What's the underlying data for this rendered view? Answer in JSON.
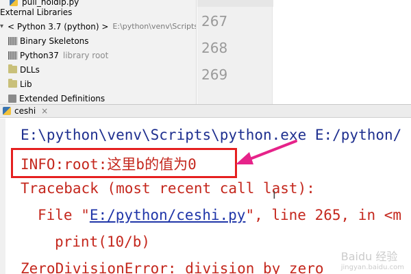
{
  "project_tree": {
    "items": [
      {
        "label": "pull_holdip.py",
        "icon": "python-file-icon"
      },
      {
        "label": "External Libraries",
        "icon": "library-icon"
      },
      {
        "label": "< Python 3.7 (python) >",
        "path": "E:\\python\\venv\\Scripts\\",
        "icon": "chevron-down-icon"
      },
      {
        "label": "Binary Skeletons",
        "icon": "library-icon"
      },
      {
        "label": "Python37",
        "hint": "library root",
        "icon": "library-icon"
      },
      {
        "label": "DLLs",
        "icon": "folder-icon"
      },
      {
        "label": "Lib",
        "icon": "folder-icon"
      },
      {
        "label": "Extended Definitions",
        "icon": "library-icon"
      }
    ]
  },
  "editor": {
    "line_numbers": [
      "267",
      "268",
      "269"
    ]
  },
  "run_panel": {
    "tab_label": "ceshi",
    "close_symbol": "×"
  },
  "console": {
    "command_line": "E:\\python\\venv\\Scripts\\python.exe E:/python/",
    "info_line": "INFO:root:这里b的值为0",
    "traceback_header": "Traceback (most recent call last):",
    "file_prefix": "File \"",
    "file_link": "E:/python/ceshi.py",
    "file_suffix": "\", line 265, in <m",
    "code_line": "print(10/b)",
    "error_line": "ZeroDivisionError: division by zero"
  },
  "annotation": {
    "highlight_color": "#e51f1f",
    "arrow_color": "#e6238a"
  },
  "watermark": {
    "text": "Baidu 经验",
    "sub": "jingyan.baidu.com"
  },
  "colors": {
    "console_command": "#1e2f8f",
    "console_error": "#c4271d",
    "link": "#1f35a8"
  }
}
